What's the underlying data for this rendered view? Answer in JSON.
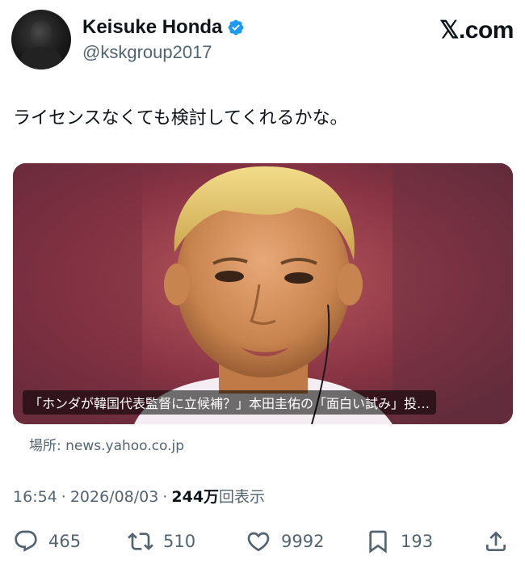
{
  "author": {
    "display_name": "Keisuke Honda",
    "handle": "@kskgroup2017",
    "verified": true,
    "avatar_icon": "avatar-portrait"
  },
  "brand": "𝕏.com",
  "tweet": {
    "text": "ライセンスなくても検討してくれるかな。"
  },
  "link_card": {
    "title": "「ホンダが韓国代表監督に立候補？」本田圭佑の「面白い試み」投…",
    "image_icon": "player-portrait-photo",
    "source": "場所: news.yahoo.co.jp"
  },
  "meta": {
    "time": "16:54",
    "separator": "·",
    "date": "2026/08/03",
    "views_count": "244万",
    "views_label": "回表示"
  },
  "actions": {
    "replies": "465",
    "retweets": "510",
    "likes": "9992",
    "bookmarks": "193"
  },
  "colors": {
    "text": "#0f1419",
    "secondary": "#536471",
    "verified": "#1d9bf0"
  }
}
